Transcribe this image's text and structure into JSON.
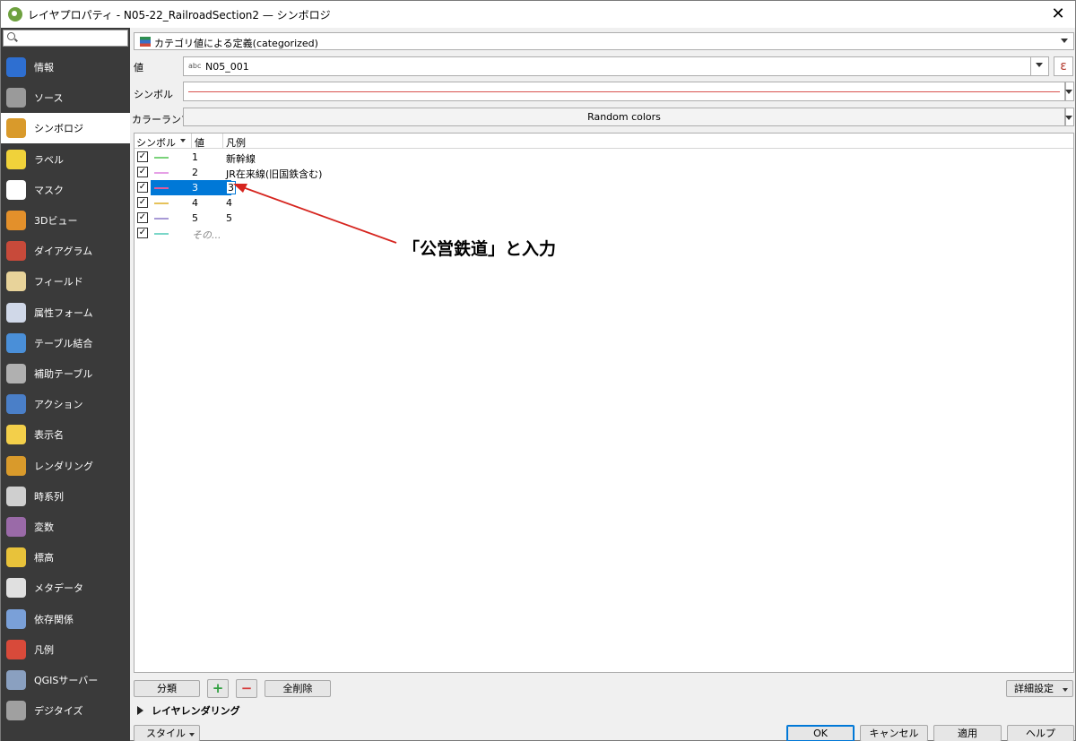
{
  "window": {
    "title": "レイヤプロパティ - N05-22_RailroadSection2 — シンボロジ",
    "close_glyph": "✕"
  },
  "sidebar": {
    "search_placeholder": "",
    "items": [
      {
        "label": "情報",
        "icon": "info-icon",
        "color": "#2e6fd1"
      },
      {
        "label": "ソース",
        "icon": "source-icon",
        "color": "#9a9a9a"
      },
      {
        "label": "シンボロジ",
        "icon": "symbology-icon",
        "color": "#d99a2b",
        "selected": true
      },
      {
        "label": "ラベル",
        "icon": "labels-icon",
        "color": "#f0d23a"
      },
      {
        "label": "マスク",
        "icon": "mask-icon",
        "color": "#ffffff"
      },
      {
        "label": "3Dビュー",
        "icon": "3d-view-icon",
        "color": "#e3902b"
      },
      {
        "label": "ダイアグラム",
        "icon": "diagram-icon",
        "color": "#c84a3a"
      },
      {
        "label": "フィールド",
        "icon": "fields-icon",
        "color": "#e8d39a"
      },
      {
        "label": "属性フォーム",
        "icon": "attribute-form-icon",
        "color": "#d0d8e8"
      },
      {
        "label": "テーブル結合",
        "icon": "joins-icon",
        "color": "#4a8fd8"
      },
      {
        "label": "補助テーブル",
        "icon": "auxiliary-storage-icon",
        "color": "#b0b0b0"
      },
      {
        "label": "アクション",
        "icon": "actions-icon",
        "color": "#4a7fc8"
      },
      {
        "label": "表示名",
        "icon": "display-icon",
        "color": "#f3cf4a"
      },
      {
        "label": "レンダリング",
        "icon": "rendering-icon",
        "color": "#d99a2b"
      },
      {
        "label": "時系列",
        "icon": "temporal-icon",
        "color": "#cfcfcf"
      },
      {
        "label": "変数",
        "icon": "variables-icon",
        "color": "#9a6aa8"
      },
      {
        "label": "標高",
        "icon": "elevation-icon",
        "color": "#e8c23a"
      },
      {
        "label": "メタデータ",
        "icon": "metadata-icon",
        "color": "#e0e0e0"
      },
      {
        "label": "依存関係",
        "icon": "dependencies-icon",
        "color": "#7aa0d8"
      },
      {
        "label": "凡例",
        "icon": "legend-icon",
        "color": "#d84a3a"
      },
      {
        "label": "QGISサーバー",
        "icon": "qgis-server-icon",
        "color": "#8aa0c0"
      },
      {
        "label": "デジタイズ",
        "icon": "digitizing-icon",
        "color": "#a0a0a0"
      }
    ]
  },
  "renderer": {
    "value": "カテゴリ値による定義(categorized)"
  },
  "fields": {
    "value_label": "値",
    "value_type": "abc",
    "value_field": "N05_001",
    "expression_glyph": "ε",
    "symbol_label": "シンボル",
    "symbol_color": "#d9534f",
    "ramp_label": "カラーランプ",
    "ramp_value": "Random colors"
  },
  "table": {
    "headers": {
      "symbol": "シンボル",
      "value": "値",
      "legend": "凡例"
    },
    "rows": [
      {
        "value": "1",
        "legend": "新幹線",
        "color": "#7ad27a"
      },
      {
        "value": "2",
        "legend": "JR在来線(旧国鉄含む)",
        "color": "#e6a0e6"
      },
      {
        "value": "3",
        "legend": "3",
        "color": "#e05a9a",
        "selected": true
      },
      {
        "value": "4",
        "legend": "4",
        "color": "#e6c25a"
      },
      {
        "value": "5",
        "legend": "5",
        "color": "#a89ad6"
      },
      {
        "value": "その...",
        "legend": "",
        "color": "#7ad6c8",
        "other": true
      }
    ]
  },
  "annotation": {
    "text": "「公営鉄道」と入力",
    "color": "#d6251f"
  },
  "buttons": {
    "classify": "分類",
    "add_glyph": "+",
    "remove_glyph": "−",
    "delete_all": "全削除",
    "advanced": "詳細設定",
    "layer_rendering": "レイヤレンダリング",
    "style": "スタイル",
    "ok": "OK",
    "cancel": "キャンセル",
    "apply": "適用",
    "help": "ヘルプ"
  }
}
